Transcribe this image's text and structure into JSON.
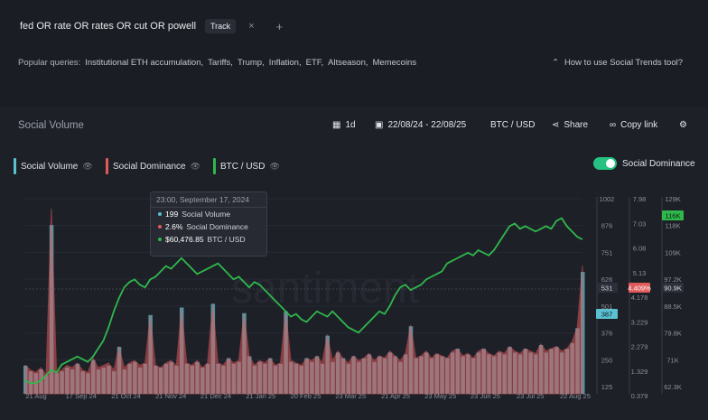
{
  "topbar": {
    "query": "fed OR rate OR rates OR cut OR powell",
    "track_label": "Track",
    "close_glyph": "×",
    "add_glyph": "+"
  },
  "popular": {
    "label": "Popular queries:",
    "items": [
      "Institutional ETH accumulation,",
      "Tariffs,",
      "Trump,",
      "Inflation,",
      "ETF,",
      "Altseason,",
      "Memecoins"
    ],
    "howto": "How to use Social Trends tool?"
  },
  "panel": {
    "title": "Social Volume",
    "interval": "1d",
    "date_range": "22/08/24 - 22/08/25",
    "pair": "BTC / USD",
    "share": "Share",
    "copy_link": "Copy link"
  },
  "legend": [
    {
      "label": "Social Volume",
      "color": "#5bc0d0"
    },
    {
      "label": "Social Dominance",
      "color": "#e05a5a"
    },
    {
      "label": "BTC / USD",
      "color": "#2fb84b"
    }
  ],
  "toggle": {
    "label": "Social Dominance",
    "on": true
  },
  "tooltip": {
    "title": "23:00, September 17, 2024",
    "rows": [
      {
        "value": "199",
        "label": "Social Volume",
        "color": "#5bc0d0"
      },
      {
        "value": "2.6%",
        "label": "Social Dominance",
        "color": "#e05a5a"
      },
      {
        "value": "$60,476.85",
        "label": "BTC / USD",
        "color": "#2fb84b"
      }
    ]
  },
  "chart_data": {
    "type": "line",
    "watermark": "santiment",
    "x_ticks": [
      "21 Aug",
      "17 Sep 24",
      "21 Oct 24",
      "21 Nov 24",
      "21 Dec 24",
      "21 Jan 25",
      "20 Feb 25",
      "23 Mar 25",
      "21 Apr 25",
      "23 May 25",
      "23 Jun 25",
      "23 Jul 25",
      "22 Aug 25"
    ],
    "axis_social_volume": [
      "1002",
      "876",
      "751",
      "626",
      "501",
      "376",
      "250",
      "125"
    ],
    "axis_social_dominance": [
      "7.98",
      "7.03",
      "6.08",
      "5.13",
      "4.178",
      "3.229",
      "2.279",
      "1.329",
      "0.379"
    ],
    "axis_btc": [
      "129K",
      "118K",
      "109K",
      "97.2K",
      "88.5K",
      "79.8K",
      "71K",
      "62.3K"
    ],
    "badges": {
      "btc_last": "116K",
      "dominance_hover": "4.409%",
      "volume_hover": "531",
      "btc_hover": "90.9K",
      "volume_last": "387"
    },
    "series": [
      {
        "name": "BTC / USD",
        "color": "#2fb84b",
        "values": [
          60,
          59,
          59,
          60,
          62,
          64,
          63,
          66,
          67,
          68,
          69,
          68,
          67,
          69,
          72,
          75,
          80,
          86,
          91,
          95,
          97,
          98,
          96,
          95,
          98,
          99,
          101,
          103,
          102,
          104,
          106,
          104,
          102,
          100,
          101,
          102,
          103,
          104,
          102,
          100,
          98,
          99,
          97,
          95,
          97,
          96,
          94,
          92,
          90,
          88,
          86,
          84,
          85,
          83,
          82,
          84,
          86,
          85,
          84,
          86,
          84,
          82,
          80,
          79,
          78,
          80,
          82,
          84,
          86,
          85,
          88,
          92,
          95,
          96,
          94,
          95,
          96,
          98,
          99,
          100,
          101,
          104,
          105,
          106,
          107,
          108,
          107,
          109,
          108,
          107,
          109,
          112,
          115,
          118,
          119,
          117,
          118,
          117,
          116,
          117,
          118,
          117,
          120,
          121,
          118,
          116,
          114,
          113
        ]
      },
      {
        "name": "Social Dominance",
        "color": "#e05a5a",
        "values": [
          1.2,
          1.0,
          0.9,
          1.1,
          0.8,
          7.8,
          0.9,
          1.0,
          1.2,
          1.1,
          1.3,
          1.0,
          0.9,
          1.5,
          1.1,
          1.2,
          1.3,
          1.0,
          2.0,
          1.1,
          1.3,
          1.4,
          1.2,
          1.3,
          3.3,
          1.2,
          1.1,
          1.3,
          1.4,
          1.2,
          3.6,
          1.3,
          1.2,
          1.4,
          1.1,
          1.3,
          3.8,
          1.3,
          1.2,
          1.5,
          1.3,
          1.4,
          3.4,
          1.6,
          1.2,
          1.4,
          1.3,
          1.5,
          1.2,
          1.3,
          3.5,
          1.4,
          1.3,
          1.2,
          1.5,
          1.4,
          1.6,
          1.3,
          2.5,
          1.4,
          1.8,
          1.5,
          1.3,
          1.6,
          1.4,
          1.5,
          1.7,
          1.4,
          1.6,
          1.5,
          1.8,
          1.6,
          1.4,
          1.7,
          2.9,
          1.5,
          1.6,
          1.8,
          1.5,
          1.7,
          1.6,
          1.5,
          1.8,
          1.9,
          1.6,
          1.7,
          1.5,
          1.8,
          1.9,
          1.7,
          1.6,
          1.8,
          1.7,
          2.0,
          1.8,
          1.7,
          1.9,
          1.8,
          1.7,
          2.1,
          1.8,
          1.9,
          2.0,
          1.8,
          1.9,
          2.2,
          2.8,
          5.4
        ]
      },
      {
        "name": "Social Volume",
        "color": "#5bc0d0",
        "values": [
          150,
          120,
          110,
          130,
          100,
          900,
          110,
          120,
          140,
          130,
          160,
          120,
          110,
          180,
          130,
          140,
          150,
          120,
          250,
          130,
          160,
          170,
          140,
          160,
          420,
          150,
          140,
          160,
          170,
          150,
          460,
          160,
          150,
          170,
          140,
          160,
          480,
          160,
          150,
          190,
          160,
          170,
          430,
          200,
          150,
          170,
          160,
          190,
          150,
          160,
          440,
          170,
          160,
          150,
          190,
          170,
          200,
          160,
          310,
          170,
          220,
          190,
          160,
          200,
          170,
          190,
          210,
          170,
          200,
          190,
          220,
          200,
          170,
          210,
          360,
          190,
          200,
          220,
          190,
          210,
          200,
          190,
          220,
          240,
          200,
          210,
          190,
          220,
          240,
          210,
          200,
          220,
          210,
          250,
          220,
          210,
          240,
          220,
          210,
          260,
          220,
          240,
          250,
          220,
          240,
          270,
          350,
          650
        ]
      }
    ]
  }
}
